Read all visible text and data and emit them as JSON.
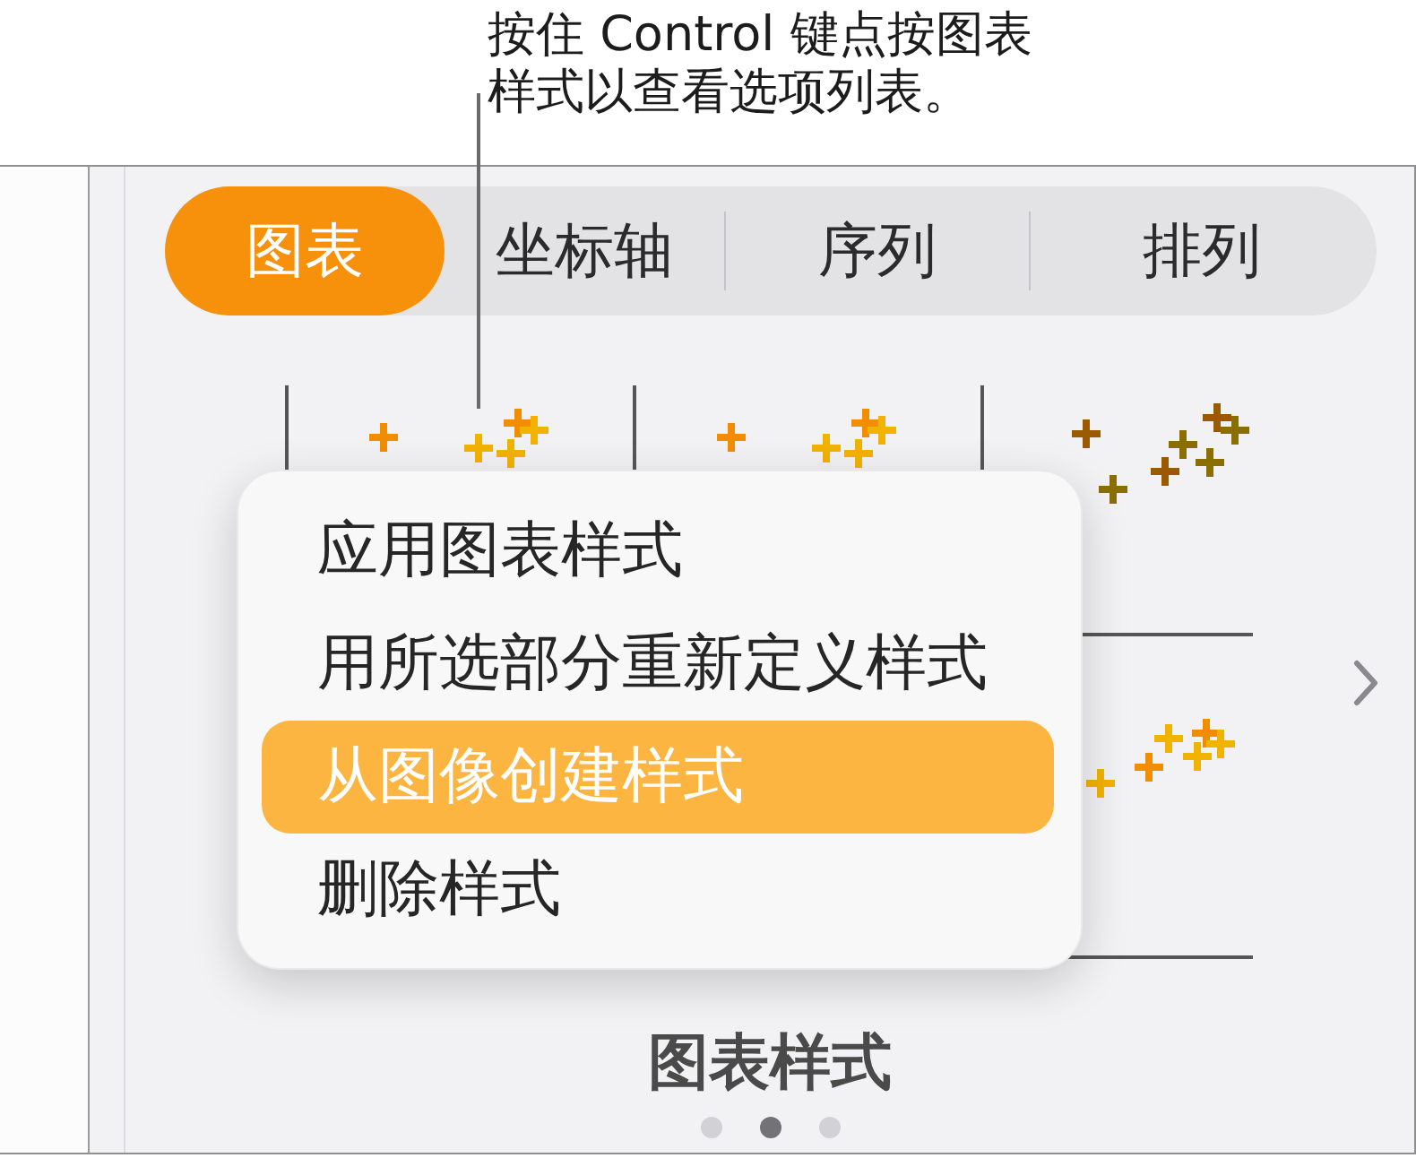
{
  "callout": {
    "text": "按住 Control 键点按图表样式以查看选项列表。"
  },
  "tabs": [
    {
      "label": "图表",
      "selected": true
    },
    {
      "label": "坐标轴",
      "selected": false
    },
    {
      "label": "序列",
      "selected": false
    },
    {
      "label": "排列",
      "selected": false
    }
  ],
  "context_menu": {
    "items": [
      {
        "label": "应用图表样式",
        "selected": false
      },
      {
        "label": "用所选部分重新定义样式",
        "selected": false
      },
      {
        "label": "从图像创建样式",
        "selected": true
      },
      {
        "label": "删除样式",
        "selected": false
      }
    ]
  },
  "chart_styles": {
    "label": "图表样式",
    "pages": [
      {
        "selected": false
      },
      {
        "selected": true
      },
      {
        "selected": false
      }
    ]
  }
}
